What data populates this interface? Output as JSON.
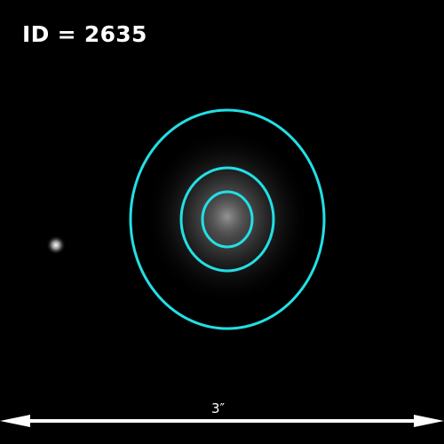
{
  "id_label": "ID = 2635",
  "scale_bar": {
    "label": "3″"
  },
  "contours": {
    "count": 3,
    "color": "#22e0e6"
  },
  "colors": {
    "background": "#000000",
    "text": "#ffffff",
    "contour": "#22e0e6"
  }
}
